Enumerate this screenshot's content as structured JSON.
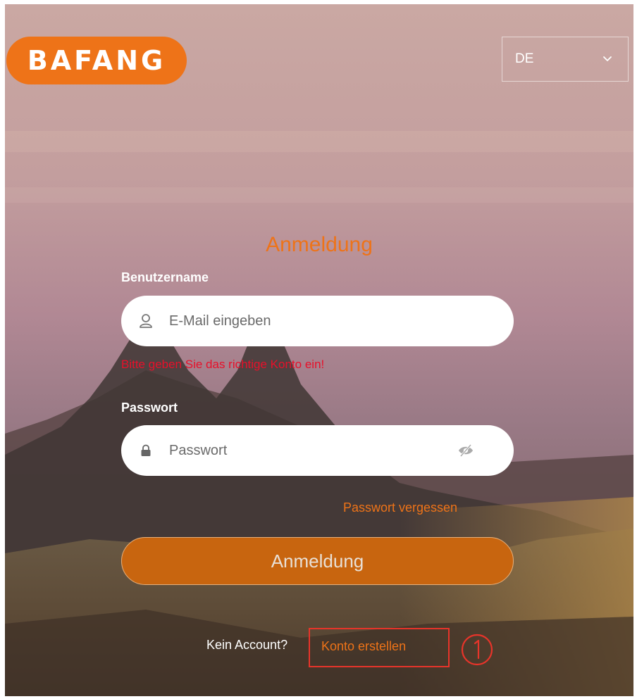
{
  "header": {
    "logo_text": "BAFANG",
    "language": "DE"
  },
  "login": {
    "title": "Anmeldung",
    "username_label": "Benutzername",
    "username_placeholder": "E-Mail eingeben",
    "error_message": "Bitte geben Sie das richtige Konto ein!",
    "password_label": "Passwort",
    "password_placeholder": "Passwort",
    "forgot_password": "Passwort vergessen",
    "submit_label": "Anmeldung",
    "no_account_text": "Kein Account?",
    "create_account_link": "Konto erstellen"
  },
  "annotation": {
    "marker_number": "①"
  },
  "icons": {
    "username": "user-icon",
    "password": "lock-icon",
    "toggle_visibility": "eye-slash-icon",
    "language_dropdown": "chevron-down-icon"
  },
  "colors": {
    "brand_orange": "#ee7318",
    "error_red": "#e8102a",
    "annotation_red": "#e8342a"
  }
}
